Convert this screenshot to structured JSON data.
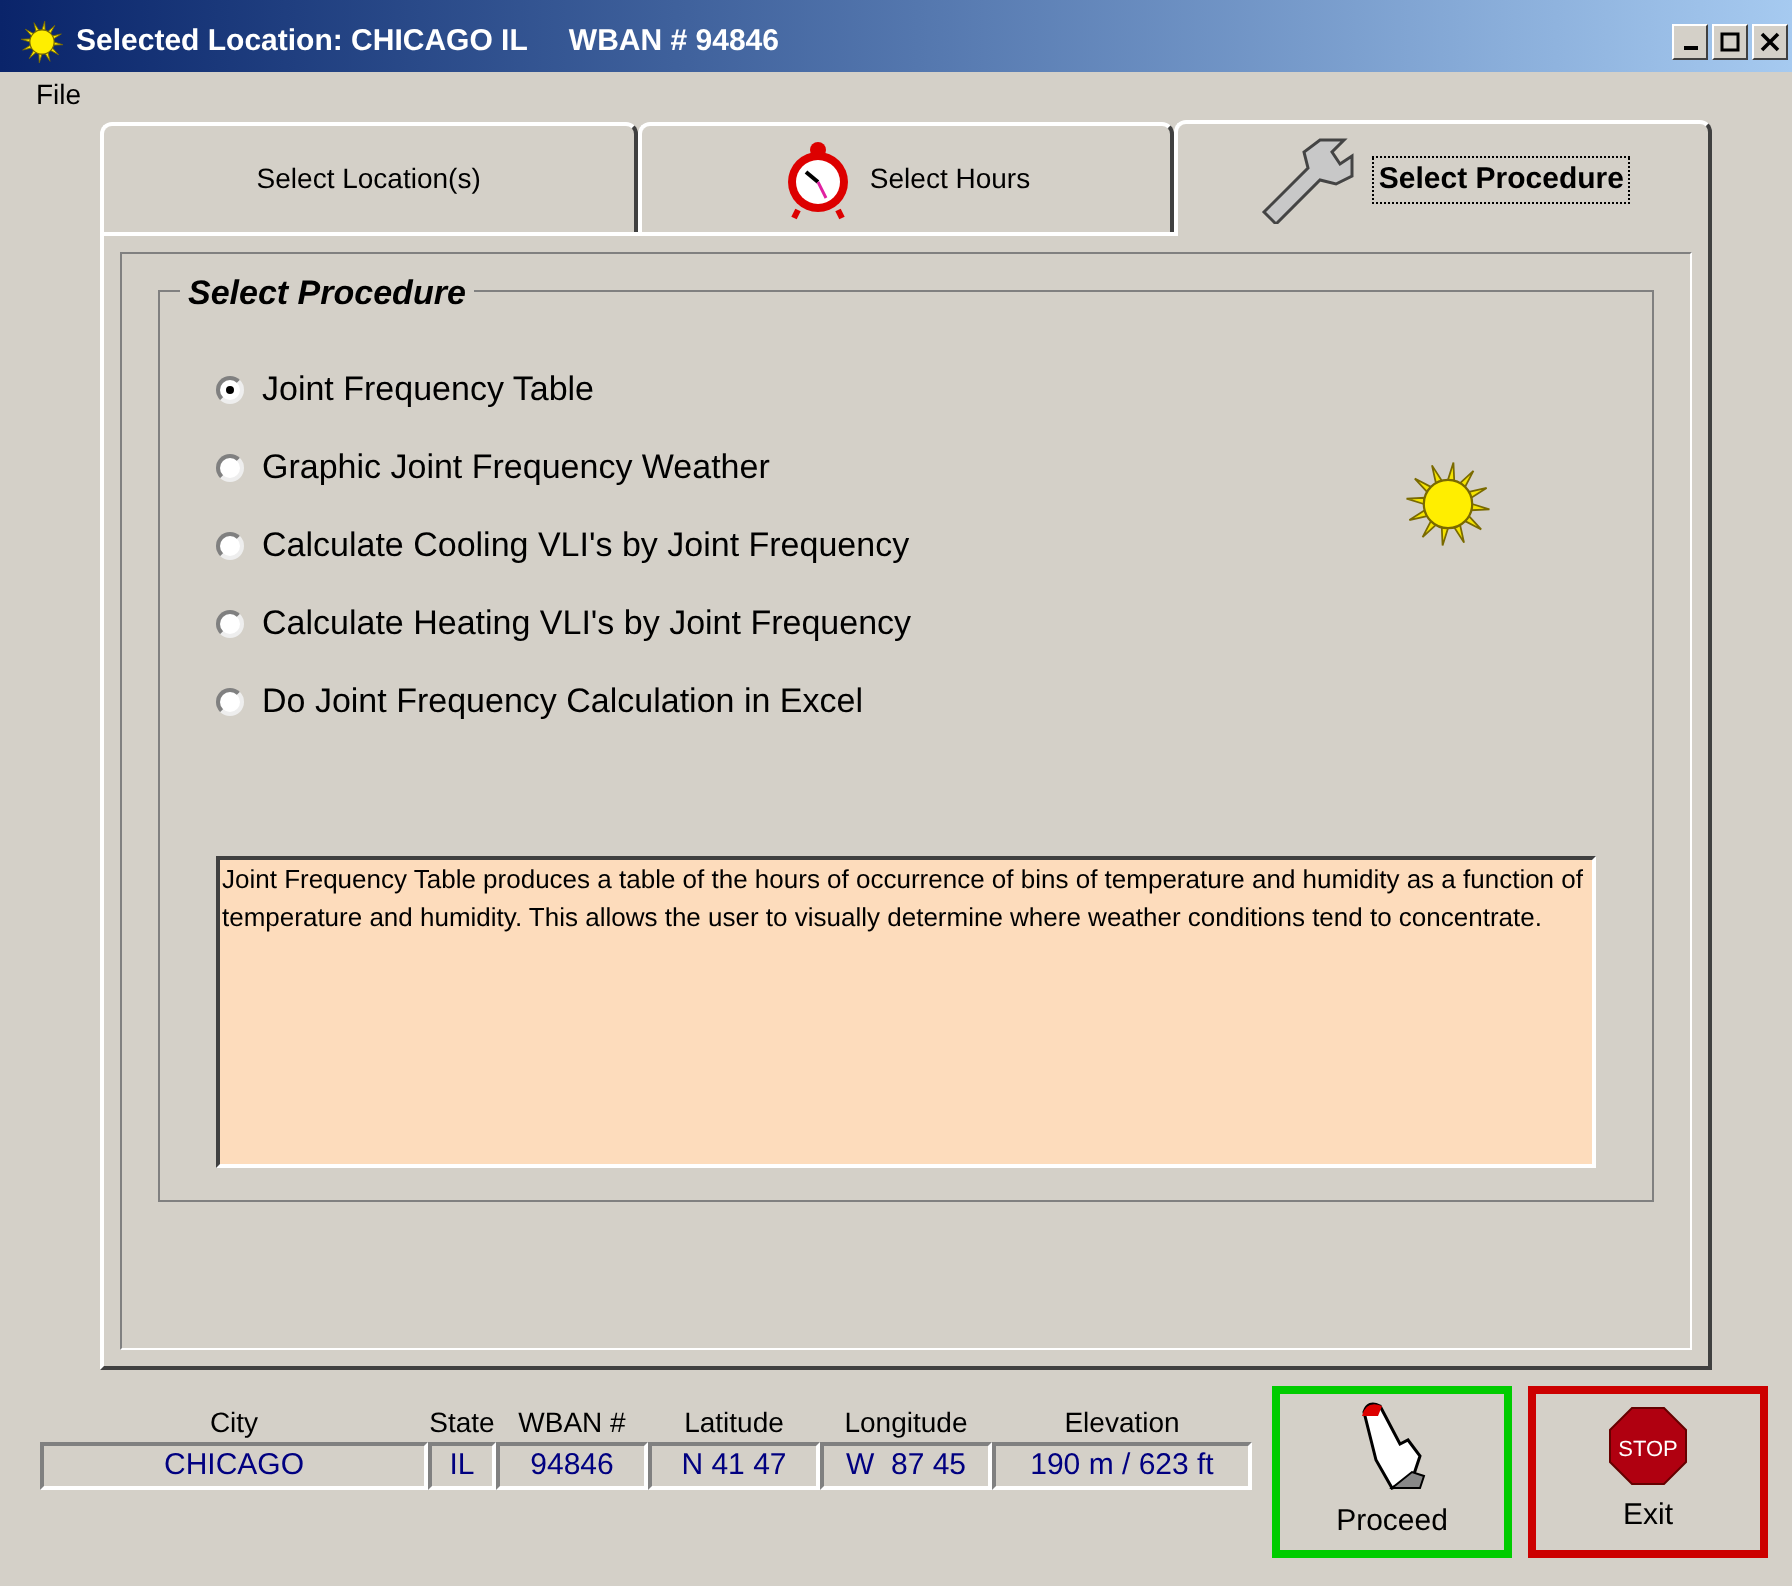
{
  "window": {
    "title": "Selected Location: CHICAGO IL     WBAN # 94846"
  },
  "menu": [
    "File"
  ],
  "tabs": [
    {
      "label": "Select Location(s)",
      "kind": "plain",
      "selected": false
    },
    {
      "label": "Select Hours",
      "kind": "hours",
      "selected": false
    },
    {
      "label": "Select Procedure",
      "kind": "procedure",
      "selected": true
    }
  ],
  "group": {
    "title": "Select Procedure"
  },
  "procedures": [
    {
      "label": "Joint Frequency Table",
      "selected": true
    },
    {
      "label": "Graphic Joint Frequency Weather",
      "selected": false
    },
    {
      "label": "Calculate Cooling VLI's by Joint Frequency",
      "selected": false
    },
    {
      "label": "Calculate Heating VLI's by Joint Frequency",
      "selected": false
    },
    {
      "label": "Do Joint Frequency Calculation in Excel",
      "selected": false
    }
  ],
  "description": "Joint Frequency Table produces a table of the hours of occurrence of bins of temperature and humidity as a function of temperature and humidity. This allows the user to visually determine where weather conditions tend to concentrate.",
  "location_fields": [
    {
      "label": "City",
      "value": "CHICAGO"
    },
    {
      "label": "State",
      "value": "IL"
    },
    {
      "label": "WBAN #",
      "value": "94846"
    },
    {
      "label": "Latitude",
      "value": "N 41 47"
    },
    {
      "label": "Longitude",
      "value": "W  87 45"
    },
    {
      "label": "Elevation",
      "value": "190 m / 623 ft"
    }
  ],
  "buttons": [
    {
      "label": "Proceed",
      "kind": "proceed"
    },
    {
      "label": "Exit",
      "kind": "exit",
      "sign": "STOP"
    }
  ]
}
